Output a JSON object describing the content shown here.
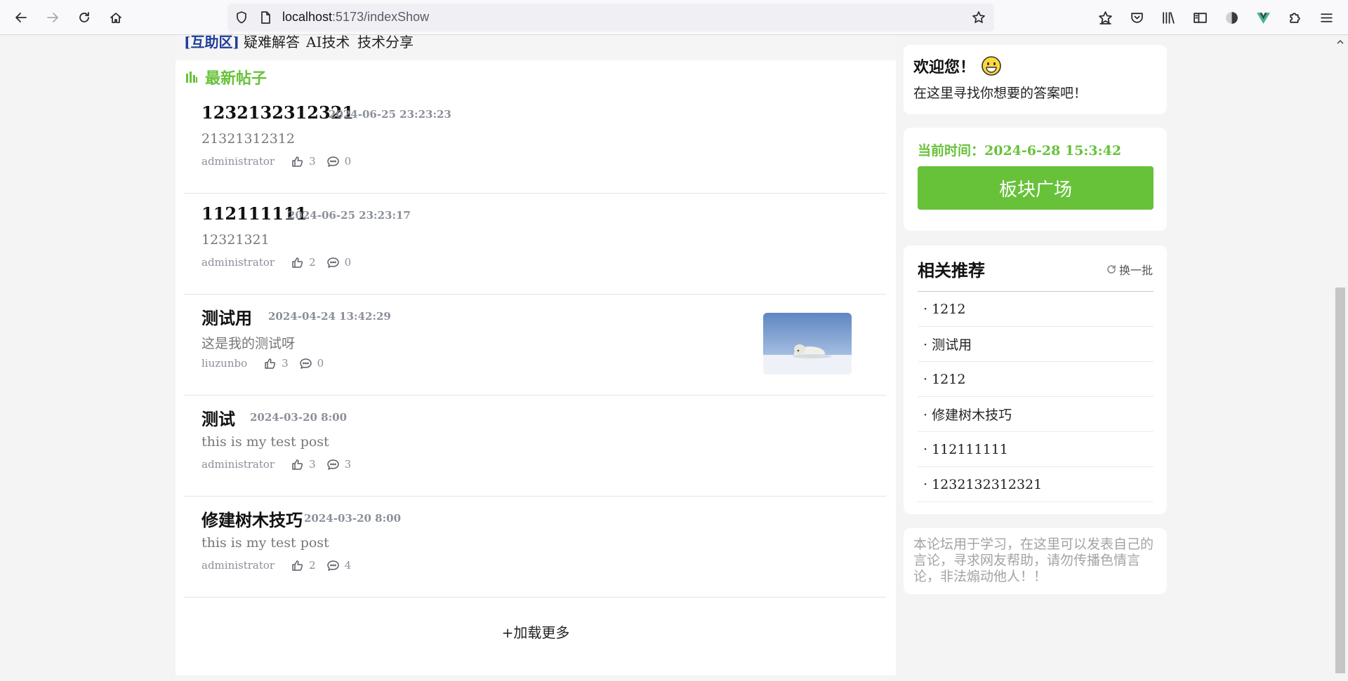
{
  "browser": {
    "url_host": "localhost",
    "url_path": ":5173/indexShow"
  },
  "topnav": {
    "bracket": "[互助区]",
    "links": [
      "疑难解答",
      "AI技术",
      "技术分享"
    ]
  },
  "section": {
    "title": "最新帖子"
  },
  "posts": [
    {
      "title": "1232132312321",
      "date": "2024-06-25 23:23:23",
      "summary": "21321312312",
      "author": "administrator",
      "likes": "3",
      "comments": "0",
      "has_image": false
    },
    {
      "title": "112111111",
      "date": "2024-06-25 23:23:17",
      "summary": "12321321",
      "author": "administrator",
      "likes": "2",
      "comments": "0",
      "has_image": false
    },
    {
      "title": "测试用",
      "date": "2024-04-24 13:42:29",
      "summary": "这是我的测试呀",
      "author": "liuzunbo",
      "likes": "3",
      "comments": "0",
      "has_image": true
    },
    {
      "title": "测试",
      "date": "2024-03-20 8:00",
      "summary": "this is my test post",
      "author": "administrator",
      "likes": "3",
      "comments": "3",
      "has_image": false
    },
    {
      "title": "修建树木技巧",
      "date": "2024-03-20 8:00",
      "summary": "this is my test post",
      "author": "administrator",
      "likes": "2",
      "comments": "4",
      "has_image": false
    }
  ],
  "load_more": "+加载更多",
  "sidebar": {
    "welcome": {
      "title": "欢迎您！",
      "subtitle": "在这里寻找你想要的答案吧！"
    },
    "time": {
      "text": "当前时间：2024-6-28 15:3:42"
    },
    "plaza_button": "板块广场",
    "recommend": {
      "title": "相关推荐",
      "refresh": "换一批",
      "items": [
        "· 1212",
        "· 测试用",
        "· 1212",
        "· 修建树木技巧",
        "· 112111111",
        "· 1232132312321"
      ]
    },
    "about": "本论坛用于学习，在这里可以发表自己的言论，寻求网友帮助，请勿传播色情言论，非法煽动他人！！"
  },
  "colors": {
    "accent": "#67c23a",
    "nav_bracket": "#1f3d99",
    "meta": "#8a8f99"
  }
}
